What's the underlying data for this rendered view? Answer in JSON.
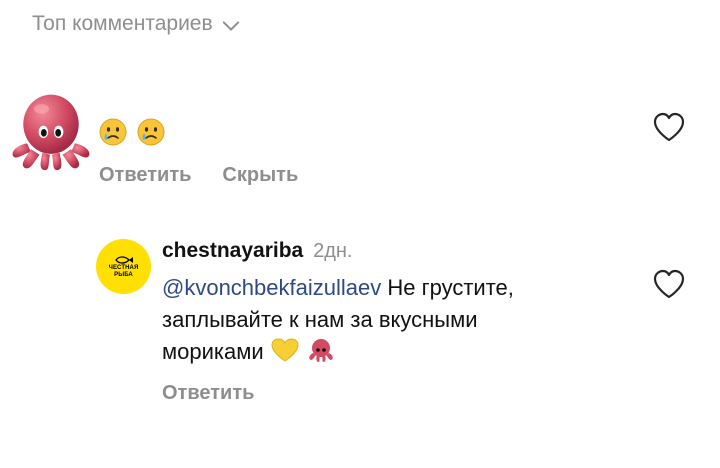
{
  "sort": {
    "label": "Топ комментариев"
  },
  "comment": {
    "emoji_icons": [
      "crying-face-icon",
      "crying-face-icon"
    ],
    "actions": {
      "reply": "Ответить",
      "hide": "Скрыть"
    }
  },
  "reply": {
    "avatar_text": [
      "ЧЕСТНАЯ",
      "РЫБА"
    ],
    "username": "chestnayariba",
    "time": "2дн.",
    "mention": "@kvonchbekfaizullaev",
    "text_1": " Не грустите,",
    "text_2": "заплывайте к нам за вкусными",
    "text_3": "мориками",
    "actions": {
      "reply": "Ответить"
    }
  },
  "colors": {
    "muted": "#8e8e8e",
    "mention": "#2d4a86",
    "brand_yellow": "#ffe000",
    "octopus": "#d24b63"
  }
}
